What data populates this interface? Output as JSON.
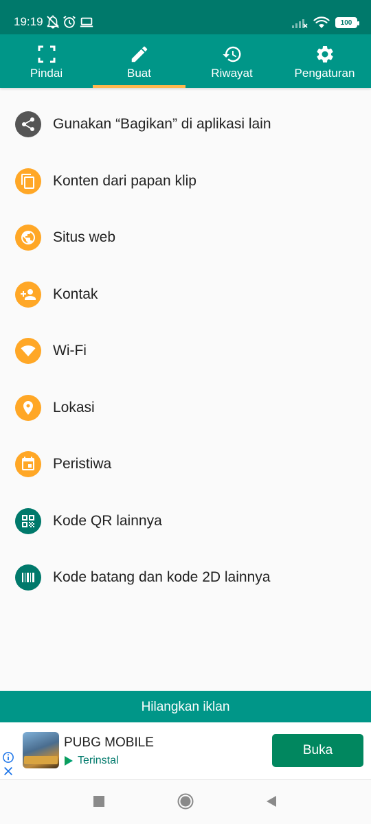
{
  "statusbar": {
    "time": "19:19",
    "battery": "100"
  },
  "tabs": [
    {
      "label": "Pindai",
      "icon": "scan-frame-icon",
      "selected": false
    },
    {
      "label": "Buat",
      "icon": "pencil-icon",
      "selected": true
    },
    {
      "label": "Riwayat",
      "icon": "history-icon",
      "selected": false
    },
    {
      "label": "Pengaturan",
      "icon": "gear-icon",
      "selected": false
    }
  ],
  "menu": [
    {
      "label": "Gunakan “Bagikan” di aplikasi lain",
      "icon": "share-icon",
      "color": "#555555"
    },
    {
      "label": "Konten dari papan klip",
      "icon": "clipboard-copy-icon",
      "color": "#ffa726"
    },
    {
      "label": "Situs web",
      "icon": "globe-icon",
      "color": "#ffa726"
    },
    {
      "label": "Kontak",
      "icon": "add-person-icon",
      "color": "#ffa726"
    },
    {
      "label": "Wi-Fi",
      "icon": "wifi-icon",
      "color": "#ffa726"
    },
    {
      "label": "Lokasi",
      "icon": "location-pin-icon",
      "color": "#ffa726"
    },
    {
      "label": "Peristiwa",
      "icon": "calendar-icon",
      "color": "#ffa726"
    },
    {
      "label": "Kode QR lainnya",
      "icon": "qr-code-icon",
      "color": "#00796b"
    },
    {
      "label": "Kode batang dan kode 2D lainnya",
      "icon": "barcode-icon",
      "color": "#00796b"
    }
  ],
  "remove_ads": {
    "label": "Hilangkan iklan"
  },
  "ad": {
    "title": "PUBG MOBILE",
    "status": "Terinstal",
    "button": "Buka"
  },
  "colors": {
    "statusbar": "#00796b",
    "tabbar": "#009688",
    "accent": "#ffb74d",
    "ad_button": "#01875f"
  }
}
